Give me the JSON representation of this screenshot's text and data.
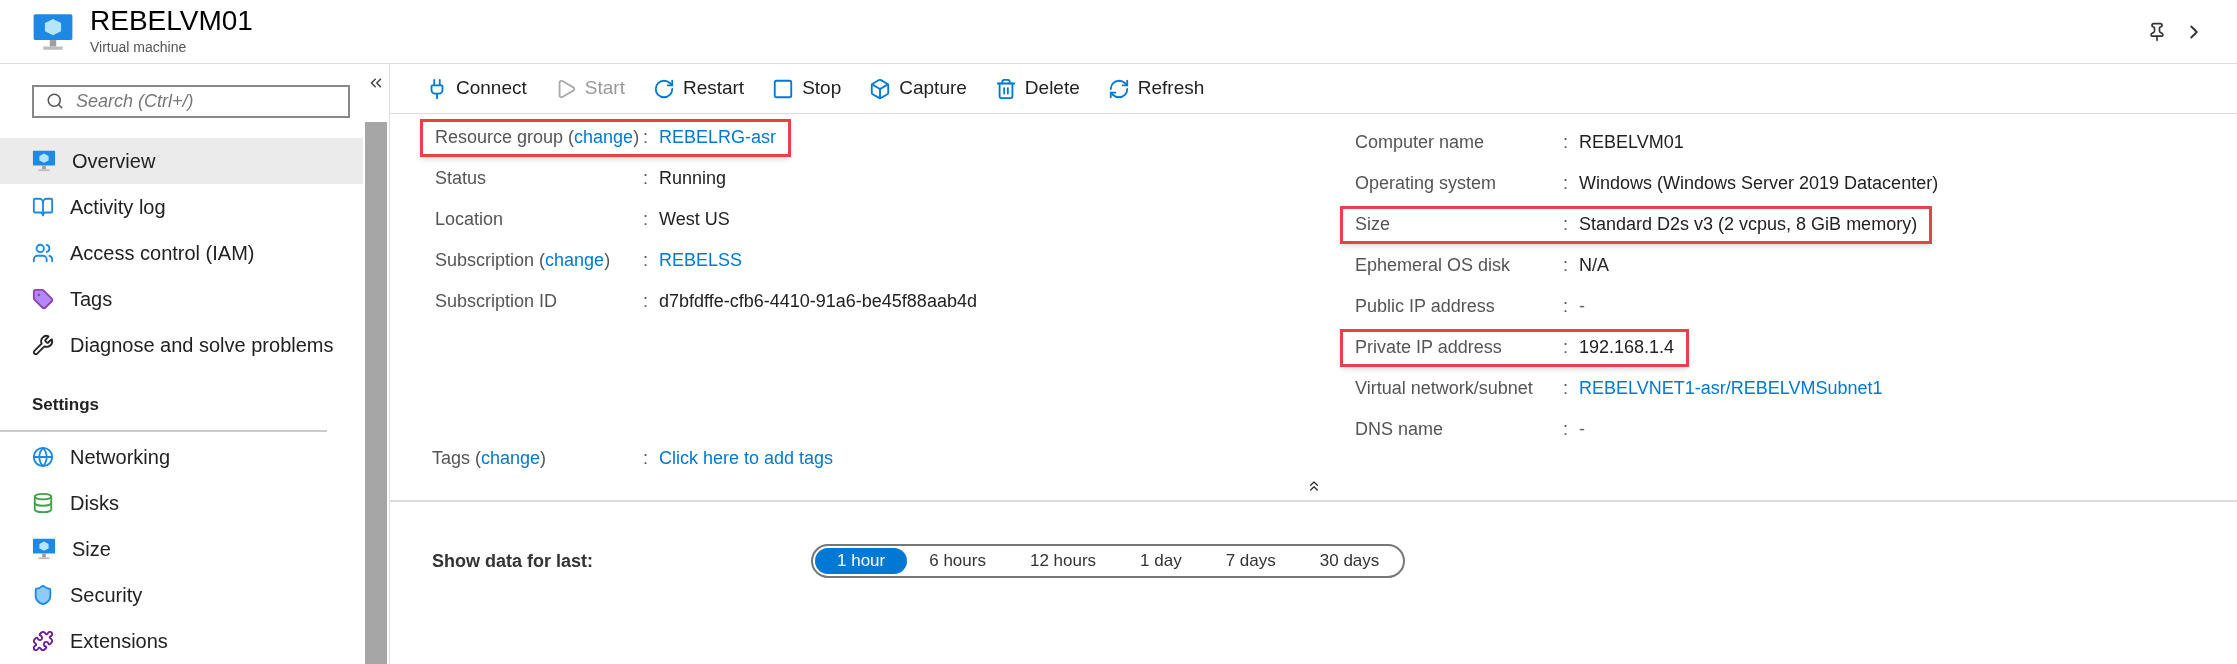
{
  "header": {
    "title": "REBELVM01",
    "subtitle": "Virtual machine"
  },
  "sidebar": {
    "search": {
      "placeholder": "Search (Ctrl+/)"
    },
    "items": [
      {
        "label": "Overview",
        "selected": true
      },
      {
        "label": "Activity log",
        "selected": false
      },
      {
        "label": "Access control (IAM)",
        "selected": false
      },
      {
        "label": "Tags",
        "selected": false
      },
      {
        "label": "Diagnose and solve problems",
        "selected": false
      }
    ],
    "section": "Settings",
    "settings_items": [
      {
        "label": "Networking",
        "selected": false
      },
      {
        "label": "Disks",
        "selected": false
      },
      {
        "label": "Size",
        "selected": false
      },
      {
        "label": "Security",
        "selected": false
      },
      {
        "label": "Extensions",
        "selected": false
      }
    ]
  },
  "toolbar": [
    {
      "label": "Connect",
      "disabled": false
    },
    {
      "label": "Start",
      "disabled": true
    },
    {
      "label": "Restart",
      "disabled": false
    },
    {
      "label": "Stop",
      "disabled": false
    },
    {
      "label": "Capture",
      "disabled": false
    },
    {
      "label": "Delete",
      "disabled": false
    },
    {
      "label": "Refresh",
      "disabled": false
    }
  ],
  "essentials_left": [
    {
      "label": "Resource group (",
      "change": "change",
      "label_end": ")",
      "separator": ":",
      "value": "REBELRG-asr",
      "kind": "link",
      "highlighted": true
    },
    {
      "label": "Status",
      "separator": ":",
      "value": "Running",
      "kind": "text",
      "highlighted": false
    },
    {
      "label": "Location",
      "separator": ":",
      "value": "West US",
      "kind": "text",
      "highlighted": false
    },
    {
      "label": "Subscription (",
      "change": "change",
      "label_end": ")",
      "separator": ":",
      "value": "REBELSS",
      "kind": "link",
      "highlighted": false
    },
    {
      "label": "Subscription ID",
      "separator": ":",
      "value": "d7bfdffe-cfb6-4410-91a6-be45f88aab4d",
      "kind": "text",
      "highlighted": false
    }
  ],
  "essentials_right": [
    {
      "label": "Computer name",
      "separator": ":",
      "value": "REBELVM01",
      "kind": "text",
      "highlighted": false
    },
    {
      "label": "Operating system",
      "separator": ":",
      "value": "Windows (Windows Server 2019 Datacenter)",
      "kind": "text",
      "highlighted": false
    },
    {
      "label": "Size",
      "separator": ":",
      "value": "Standard D2s v3 (2 vcpus, 8 GiB memory)",
      "kind": "text",
      "highlighted": true
    },
    {
      "label": "Ephemeral OS disk",
      "separator": ":",
      "value": "N/A",
      "kind": "text",
      "highlighted": false
    },
    {
      "label": "Public IP address",
      "separator": ":",
      "value": "-",
      "kind": "dim",
      "highlighted": false
    },
    {
      "label": "Private IP address",
      "separator": ":",
      "value": "192.168.1.4",
      "kind": "text",
      "highlighted": true
    },
    {
      "label": "Virtual network/subnet",
      "separator": ":",
      "value": "REBELVNET1-asr/REBELVMSubnet1",
      "kind": "link",
      "highlighted": false
    },
    {
      "label": "DNS name",
      "separator": ":",
      "value": "-",
      "kind": "dim",
      "highlighted": false
    }
  ],
  "tags": {
    "label": "Tags (",
    "change": "change",
    "label_end": ")",
    "separator": ":",
    "value": "Click here to add tags"
  },
  "time_range": {
    "label": "Show data for last:",
    "options": [
      {
        "label": "1 hour",
        "selected": true
      },
      {
        "label": "6 hours",
        "selected": false
      },
      {
        "label": "12 hours",
        "selected": false
      },
      {
        "label": "1 day",
        "selected": false
      },
      {
        "label": "7 days",
        "selected": false
      },
      {
        "label": "30 days",
        "selected": false
      }
    ]
  }
}
